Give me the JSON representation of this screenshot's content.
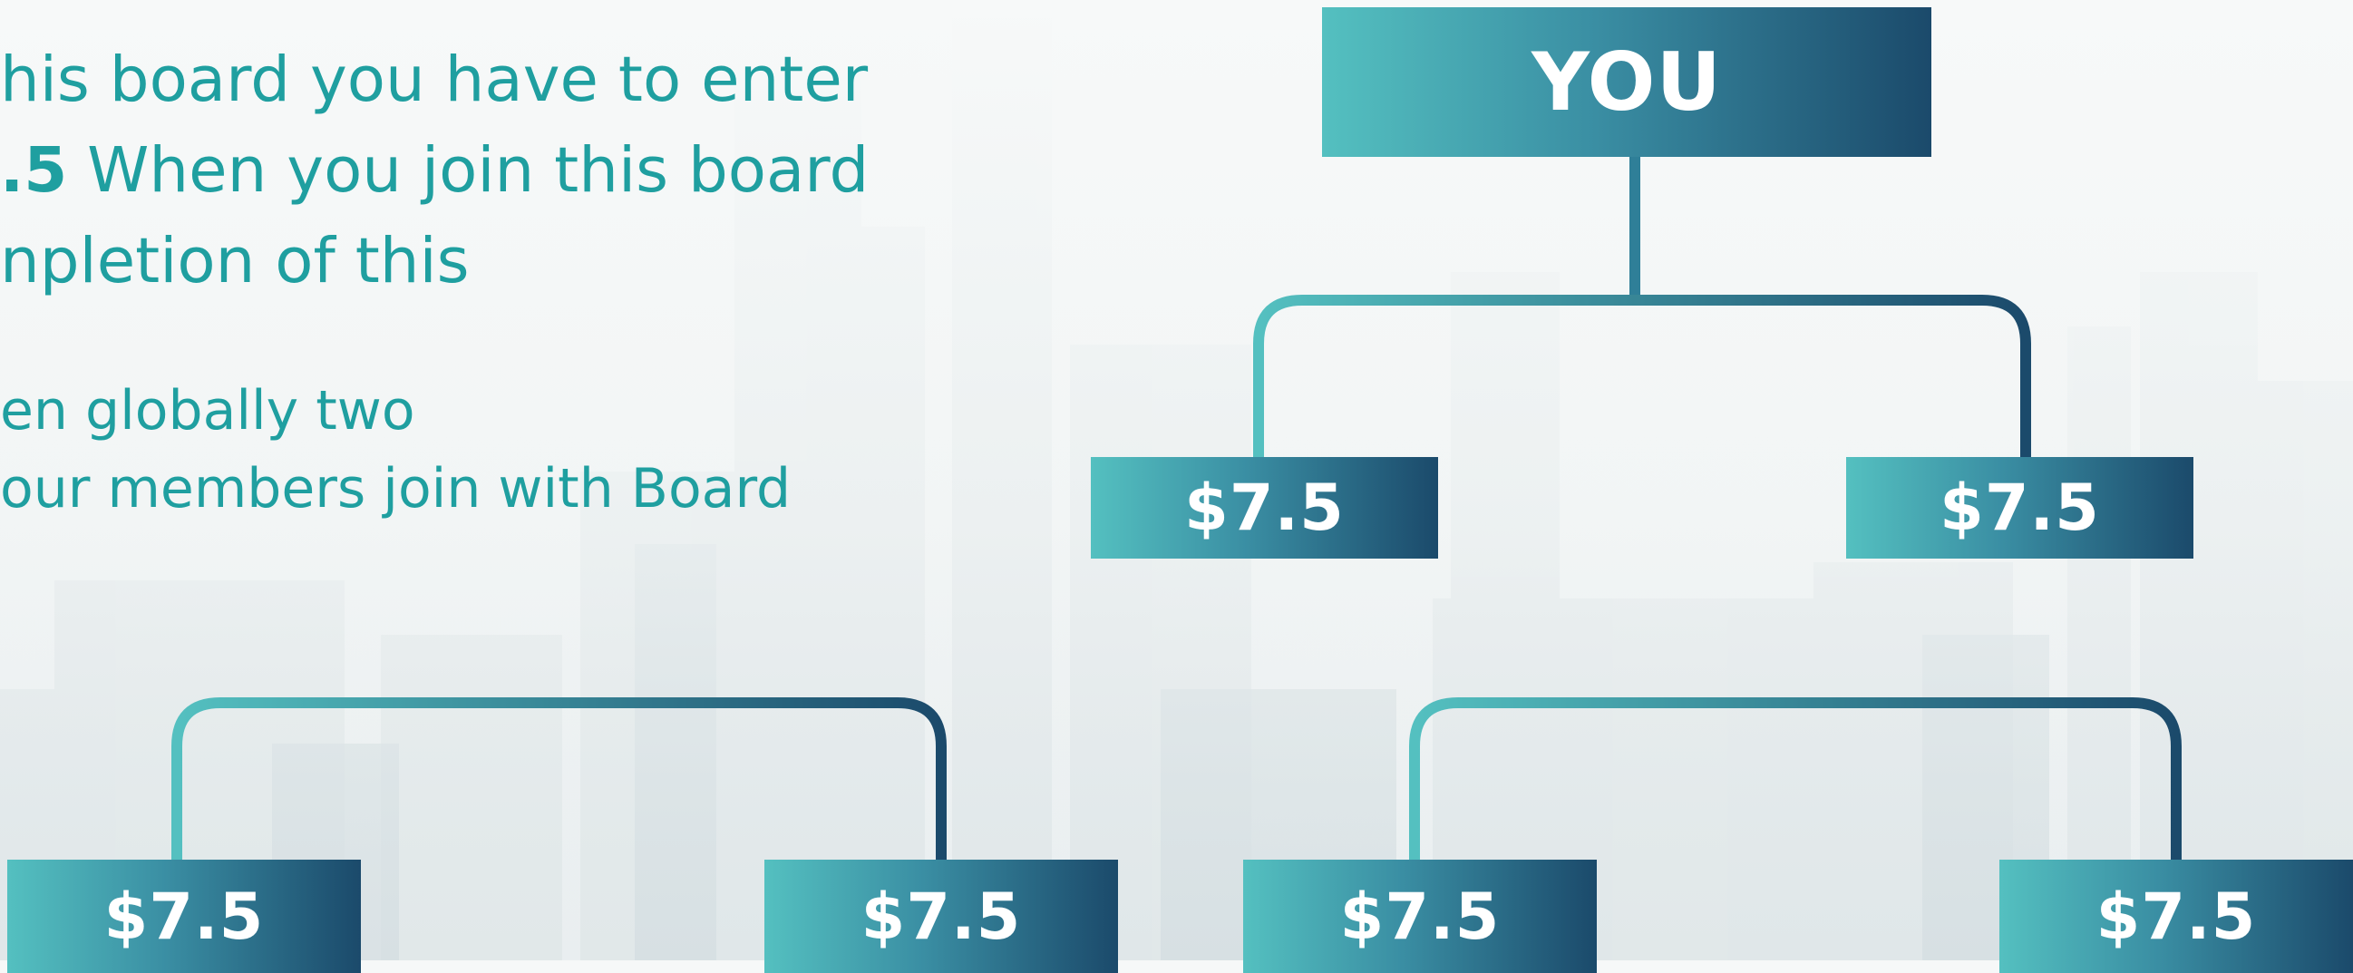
{
  "description": {
    "paragraph1": [
      {
        "text": "his board you have to enter"
      },
      {
        "bold": ".5",
        "text": " When you join this board"
      },
      {
        "text": "npletion of this"
      }
    ],
    "paragraph2": [
      {
        "text": "en globally two"
      },
      {
        "text": "our members join with Board"
      }
    ]
  },
  "tree": {
    "root": {
      "label": "YOU"
    },
    "level2": [
      {
        "label": "$7.5"
      },
      {
        "label": "$7.5"
      }
    ],
    "level3": [
      {
        "label": "$7.5"
      },
      {
        "label": "$7.5"
      },
      {
        "label": "$7.5"
      },
      {
        "label": "$7.5"
      }
    ]
  },
  "colors": {
    "text_teal": "#1f9fa0",
    "node_gradient_start": "#54c0c0",
    "node_gradient_end": "#1b4a6b"
  }
}
